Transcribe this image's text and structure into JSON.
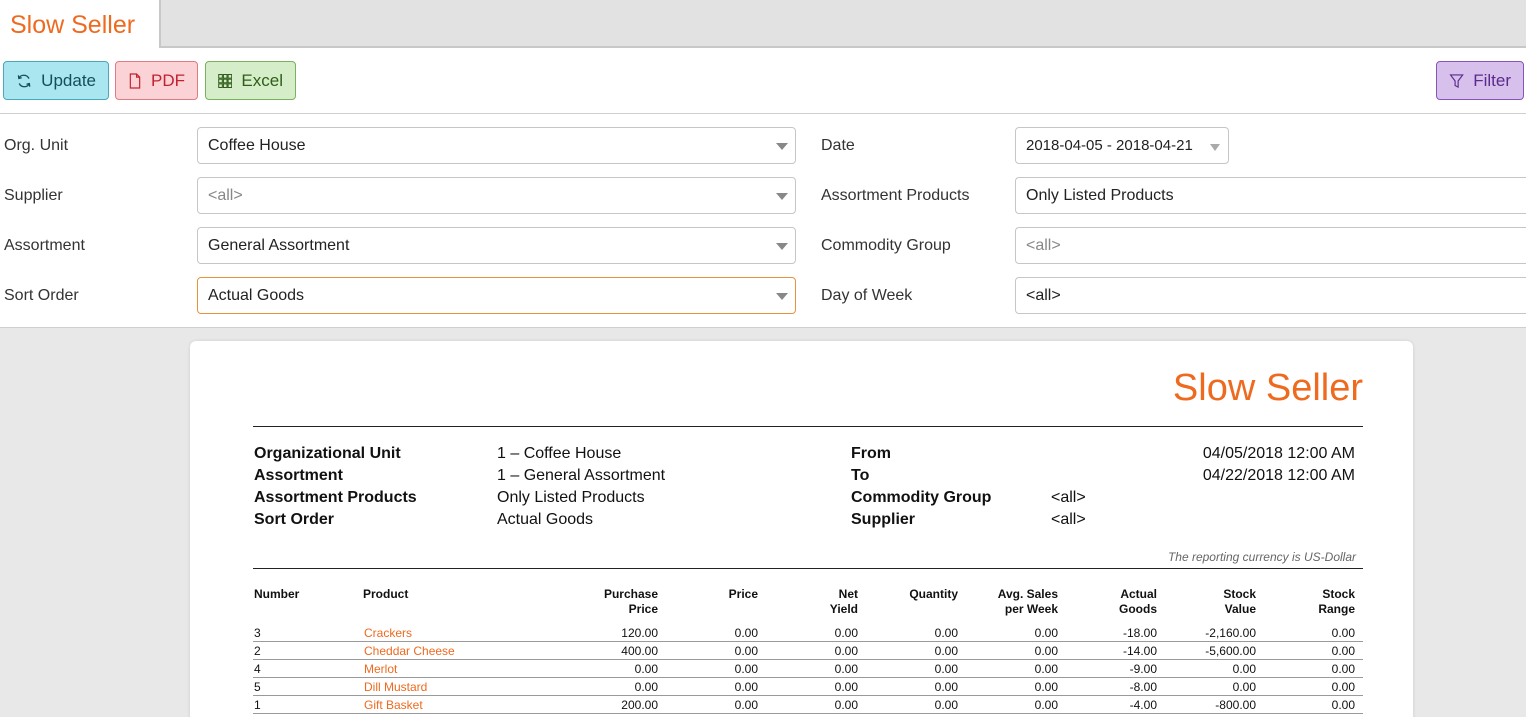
{
  "tab": {
    "title": "Slow Seller"
  },
  "toolbar": {
    "update": "Update",
    "pdf": "PDF",
    "excel": "Excel",
    "filter": "Filter"
  },
  "filters": {
    "org_unit": {
      "label": "Org. Unit",
      "value": "Coffee House"
    },
    "supplier": {
      "label": "Supplier",
      "value": "<all>"
    },
    "assortment": {
      "label": "Assortment",
      "value": "General Assortment"
    },
    "sort_order": {
      "label": "Sort Order",
      "value": "Actual Goods"
    },
    "date": {
      "label": "Date",
      "value": "2018-04-05 - 2018-04-21"
    },
    "assortment_products": {
      "label": "Assortment Products",
      "value": "Only Listed Products"
    },
    "commodity_group": {
      "label": "Commodity Group",
      "value": "<all>"
    },
    "day_of_week": {
      "label": "Day of Week",
      "value": "<all>"
    }
  },
  "report": {
    "title": "Slow Seller",
    "info_left": [
      {
        "label": "Organizational Unit",
        "value": "1 – Coffee House"
      },
      {
        "label": "Assortment",
        "value": "1 – General Assortment"
      },
      {
        "label": "Assortment Products",
        "value": "Only Listed Products"
      },
      {
        "label": "Sort Order",
        "value": "Actual Goods"
      }
    ],
    "info_right": [
      {
        "label": "From",
        "value": "04/05/2018 12:00 AM"
      },
      {
        "label": "To",
        "value": "04/22/2018 12:00 AM"
      },
      {
        "label": "Commodity Group",
        "value": "<all>"
      },
      {
        "label": "Supplier",
        "value": "<all>"
      }
    ],
    "currency_note": "The reporting currency is US-Dollar",
    "columns": [
      {
        "l1": "Number",
        "l2": ""
      },
      {
        "l1": "Product",
        "l2": ""
      },
      {
        "l1": "Purchase",
        "l2": "Price"
      },
      {
        "l1": "Price",
        "l2": ""
      },
      {
        "l1": "Net",
        "l2": "Yield"
      },
      {
        "l1": "Quantity",
        "l2": ""
      },
      {
        "l1": "Avg. Sales",
        "l2": "per Week"
      },
      {
        "l1": "Actual",
        "l2": "Goods"
      },
      {
        "l1": "Stock",
        "l2": "Value"
      },
      {
        "l1": "Stock",
        "l2": "Range"
      }
    ],
    "rows": [
      {
        "number": "3",
        "product": "Crackers",
        "purchase_price": "120.00",
        "price": "0.00",
        "net_yield": "0.00",
        "quantity": "0.00",
        "avg_sales": "0.00",
        "actual_goods": "-18.00",
        "stock_value": "-2,160.00",
        "stock_range": "0.00"
      },
      {
        "number": "2",
        "product": "Cheddar Cheese",
        "purchase_price": "400.00",
        "price": "0.00",
        "net_yield": "0.00",
        "quantity": "0.00",
        "avg_sales": "0.00",
        "actual_goods": "-14.00",
        "stock_value": "-5,600.00",
        "stock_range": "0.00"
      },
      {
        "number": "4",
        "product": "Merlot",
        "purchase_price": "0.00",
        "price": "0.00",
        "net_yield": "0.00",
        "quantity": "0.00",
        "avg_sales": "0.00",
        "actual_goods": "-9.00",
        "stock_value": "0.00",
        "stock_range": "0.00"
      },
      {
        "number": "5",
        "product": "Dill Mustard",
        "purchase_price": "0.00",
        "price": "0.00",
        "net_yield": "0.00",
        "quantity": "0.00",
        "avg_sales": "0.00",
        "actual_goods": "-8.00",
        "stock_value": "0.00",
        "stock_range": "0.00"
      },
      {
        "number": "1",
        "product": "Gift Basket",
        "purchase_price": "200.00",
        "price": "0.00",
        "net_yield": "0.00",
        "quantity": "0.00",
        "avg_sales": "0.00",
        "actual_goods": "-4.00",
        "stock_value": "-800.00",
        "stock_range": "0.00"
      }
    ]
  }
}
